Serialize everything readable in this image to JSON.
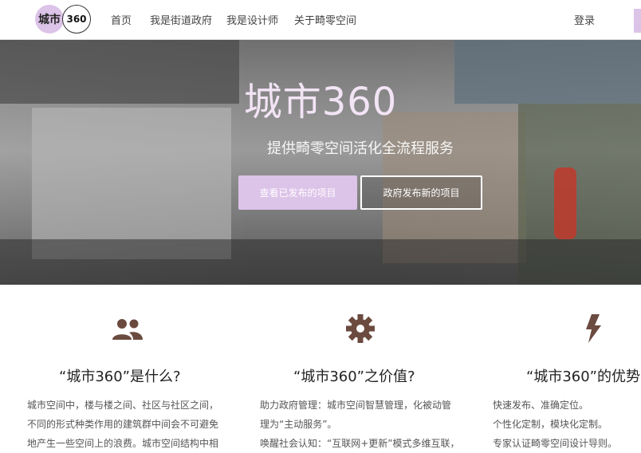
{
  "nav": {
    "logo_left": "城市",
    "logo_right": "360",
    "items": [
      "首页",
      "我是街道政府",
      "我是设计师",
      "关于畸零空间"
    ],
    "login": "登录"
  },
  "hero": {
    "title": "城市360",
    "subtitle": "提供畸零空间活化全流程服务",
    "primary_button": "查看已发布的项目",
    "secondary_button": "政府发布新的项目"
  },
  "features": [
    {
      "icon": "people-icon",
      "title": "“城市360”是什么?",
      "lines": [
        "城市空间中，楼与楼之间、社区与社区之间，",
        "不同的形式种类作用的建筑群中间会不可避免",
        "地产生一些空间上的浪费。城市空间结构中相"
      ]
    },
    {
      "icon": "gear-icon",
      "title": "“城市360”之价值?",
      "lines": [
        "助力政府管理：城市空间智慧管理，化被动管",
        "理为“主动服务”。",
        "唤醒社会认知：“互联网+更新”模式多维互联，"
      ]
    },
    {
      "icon": "lightning-icon",
      "title": "“城市360”的优势",
      "lines": [
        "快速发布、准确定位。",
        "个性化定制，模块化定制。",
        "专家认证畸零空间设计导则。"
      ]
    }
  ],
  "colors": {
    "accent": "#dcc3e8",
    "icon": "#6b4a3f"
  }
}
